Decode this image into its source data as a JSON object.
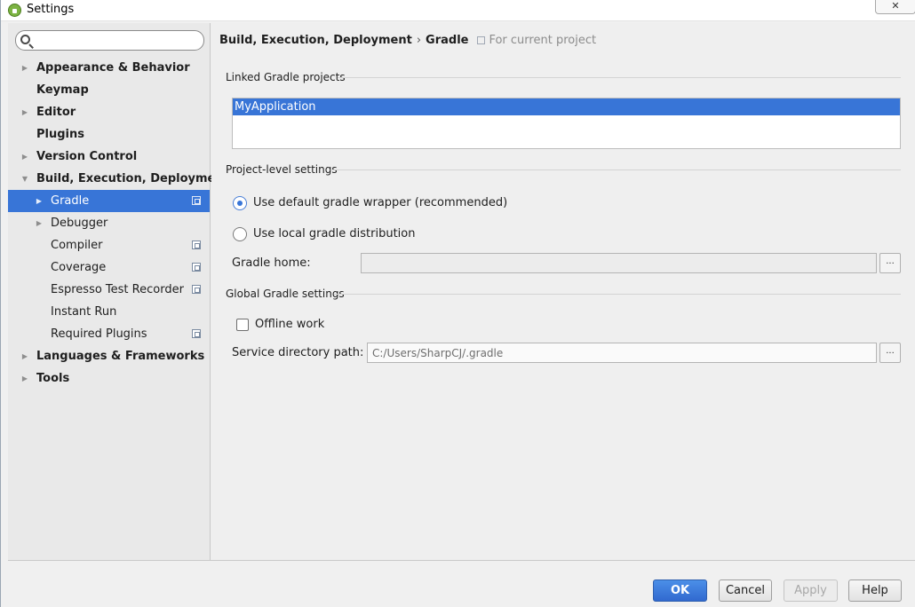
{
  "window": {
    "title": "Settings",
    "close_glyph": "✕"
  },
  "search": {
    "placeholder": "",
    "value": ""
  },
  "tree": {
    "appearance": "Appearance & Behavior",
    "keymap": "Keymap",
    "editor": "Editor",
    "plugins": "Plugins",
    "version_control": "Version Control",
    "build": "Build, Execution, Deployment",
    "gradle": "Gradle",
    "debugger": "Debugger",
    "compiler": "Compiler",
    "coverage": "Coverage",
    "espresso": "Espresso Test Recorder",
    "instant_run": "Instant Run",
    "required_plugins": "Required Plugins",
    "languages": "Languages & Frameworks",
    "tools": "Tools"
  },
  "breadcrumb": {
    "parent": "Build, Execution, Deployment",
    "separator": "›",
    "current": "Gradle",
    "scope": "For current project"
  },
  "linked": {
    "title": "Linked Gradle projects",
    "projects": [
      "MyApplication"
    ]
  },
  "project_level": {
    "title": "Project-level settings",
    "option_wrapper": "Use default gradle wrapper (recommended)",
    "option_local": "Use local gradle distribution",
    "gradle_home_label": "Gradle home:",
    "gradle_home_value": "",
    "selected_option": "wrapper"
  },
  "global": {
    "title": "Global Gradle settings",
    "offline_label": "Offline work",
    "offline_checked": false,
    "service_dir_label": "Service directory path:",
    "service_dir_value": "C:/Users/SharpCJ/.gradle"
  },
  "browse_label": "...",
  "buttons": {
    "ok": "OK",
    "cancel": "Cancel",
    "apply": "Apply",
    "help": "Help"
  },
  "colors": {
    "selection": "#3875d7",
    "primary_button": "#3a78dc"
  }
}
